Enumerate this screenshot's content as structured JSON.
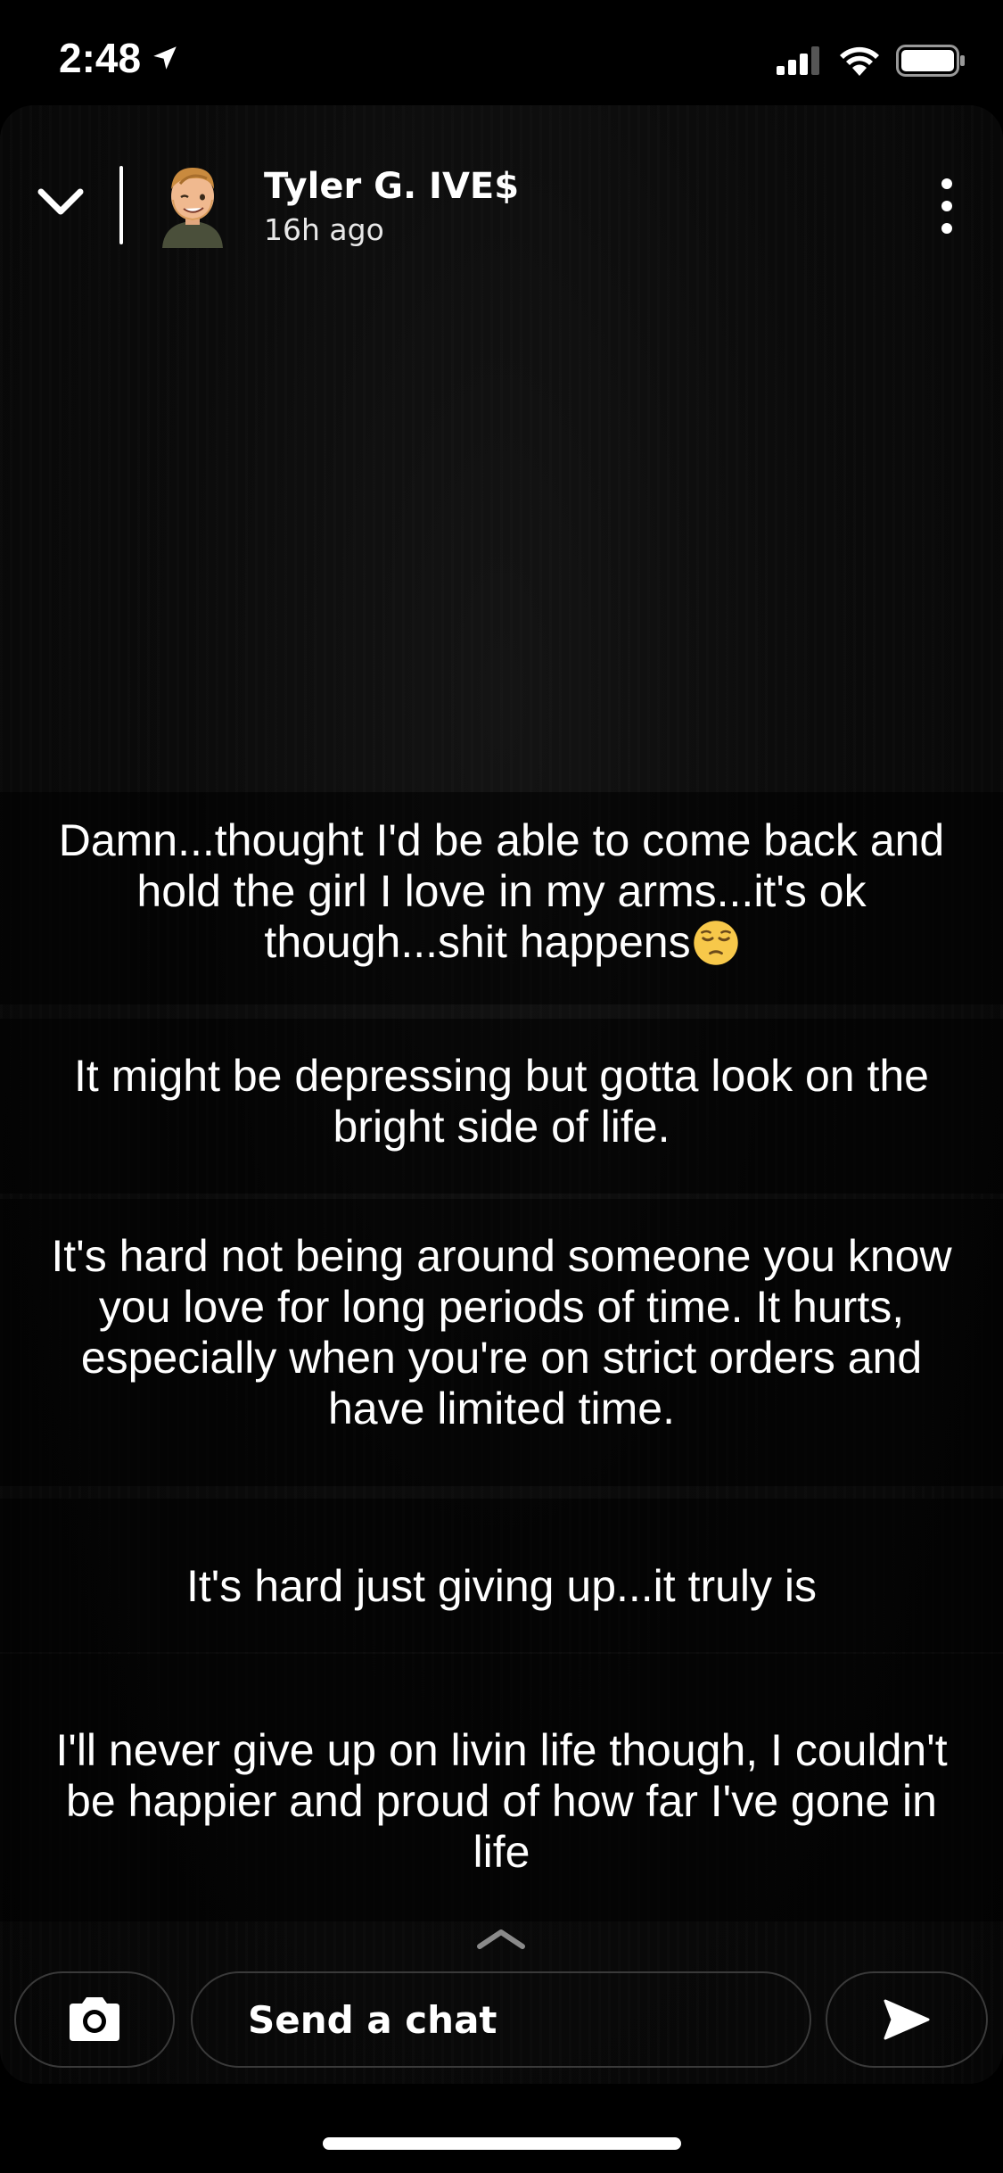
{
  "status_bar": {
    "time": "2:48",
    "icons": [
      "location-arrow-icon",
      "cellular-signal-icon",
      "wifi-icon",
      "battery-icon"
    ]
  },
  "header": {
    "user_name": "Tyler G. IVE$",
    "time_ago": "16h ago",
    "icons": [
      "chevron-down-icon",
      "bitmoji-avatar",
      "more-vertical-icon"
    ]
  },
  "captions": [
    {
      "text": "Damn...thought I'd be able to come back and hold the girl I love in my arms...it's ok though...shit happens",
      "emoji": "pensive-face"
    },
    {
      "text": "It might be depressing but gotta look on the bright side of life."
    },
    {
      "text": "It's hard not being around someone you know you love for long periods of time. It hurts, especially when you're on strict orders and have limited time."
    },
    {
      "text": "It's hard just giving up...it truly is"
    },
    {
      "text": "I'll never give up on livin life though, I couldn't be happier and proud of how far I've gone in life"
    }
  ],
  "chat_bar": {
    "placeholder": "Send a chat",
    "icons": [
      "chevron-up-icon",
      "camera-icon",
      "send-arrow-icon"
    ]
  },
  "colors": {
    "background": "#000000",
    "text": "#ffffff",
    "button_border": "#3a3a3a"
  }
}
